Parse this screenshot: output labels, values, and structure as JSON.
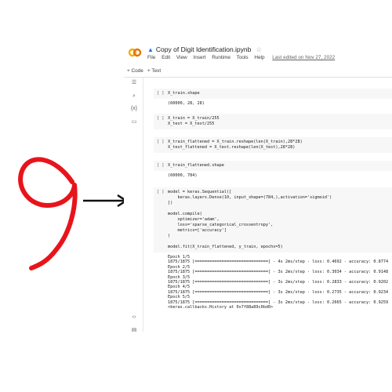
{
  "app": {
    "title": "Copy of Digit Identification.ipynb",
    "last_edited": "Last edited on Nov 27, 2022"
  },
  "menu": [
    "File",
    "Edit",
    "View",
    "Insert",
    "Runtime",
    "Tools",
    "Help"
  ],
  "toolbar": {
    "code": "+ Code",
    "text": "+ Text"
  },
  "sidebar_icons": [
    "menu-icon",
    "search-icon",
    "variables-icon",
    "folder-icon",
    "code-snippets-icon",
    "terminal-icon"
  ],
  "cells": [
    {
      "run": "[ ]",
      "code": [
        "X_train.shape"
      ],
      "output": [
        "(60000, 28, 28)"
      ]
    },
    {
      "run": "[ ]",
      "code": [
        "X_train = X_train/255",
        "X_test = X_test/255"
      ],
      "output": []
    },
    {
      "run": "[ ]",
      "code": [
        "X_train_flattened = X_train.reshape(len(X_train),28*28)",
        "X_test_flattened = X_test.reshape(len(X_test),28*28)"
      ],
      "output": []
    },
    {
      "run": "[ ]",
      "code": [
        "X_train_flattened.shape"
      ],
      "output": [
        "(60000, 784)"
      ]
    },
    {
      "run": "[ ]",
      "code": [
        "model = keras.Sequential([",
        "    keras.layers.Dense(10, input_shape=(784,),activation='sigmoid')",
        "])",
        "",
        "model.compile(",
        "    optimizer='adam',",
        "    loss='sparse_categorical_crossentropy',",
        "    metrics=['accuracy']",
        ")",
        "",
        "model.fit(X_train_flattened, y_train, epochs=5)"
      ],
      "output": [
        "Epoch 1/5",
        "1875/1875 [==============================] - 4s 2ms/step - loss: 0.4692 - accuracy: 0.8774",
        "Epoch 2/5",
        "1875/1875 [==============================] - 3s 2ms/step - loss: 0.3034 - accuracy: 0.9148",
        "Epoch 3/5",
        "1875/1875 [==============================] - 3s 2ms/step - loss: 0.2833 - accuracy: 0.9202",
        "Epoch 4/5",
        "1875/1875 [==============================] - 3s 2ms/step - loss: 0.2735 - accuracy: 0.9234",
        "Epoch 5/5",
        "1875/1875 [==============================] - 3s 2ms/step - loss: 0.2665 - accuracy: 0.9259",
        "<keras.callbacks.History at 0x7f88a89c0bd0>"
      ]
    }
  ],
  "annotation": {
    "digit_drawing": "handwritten-nine",
    "arrow": "arrow-right",
    "color": "#e8141b"
  }
}
